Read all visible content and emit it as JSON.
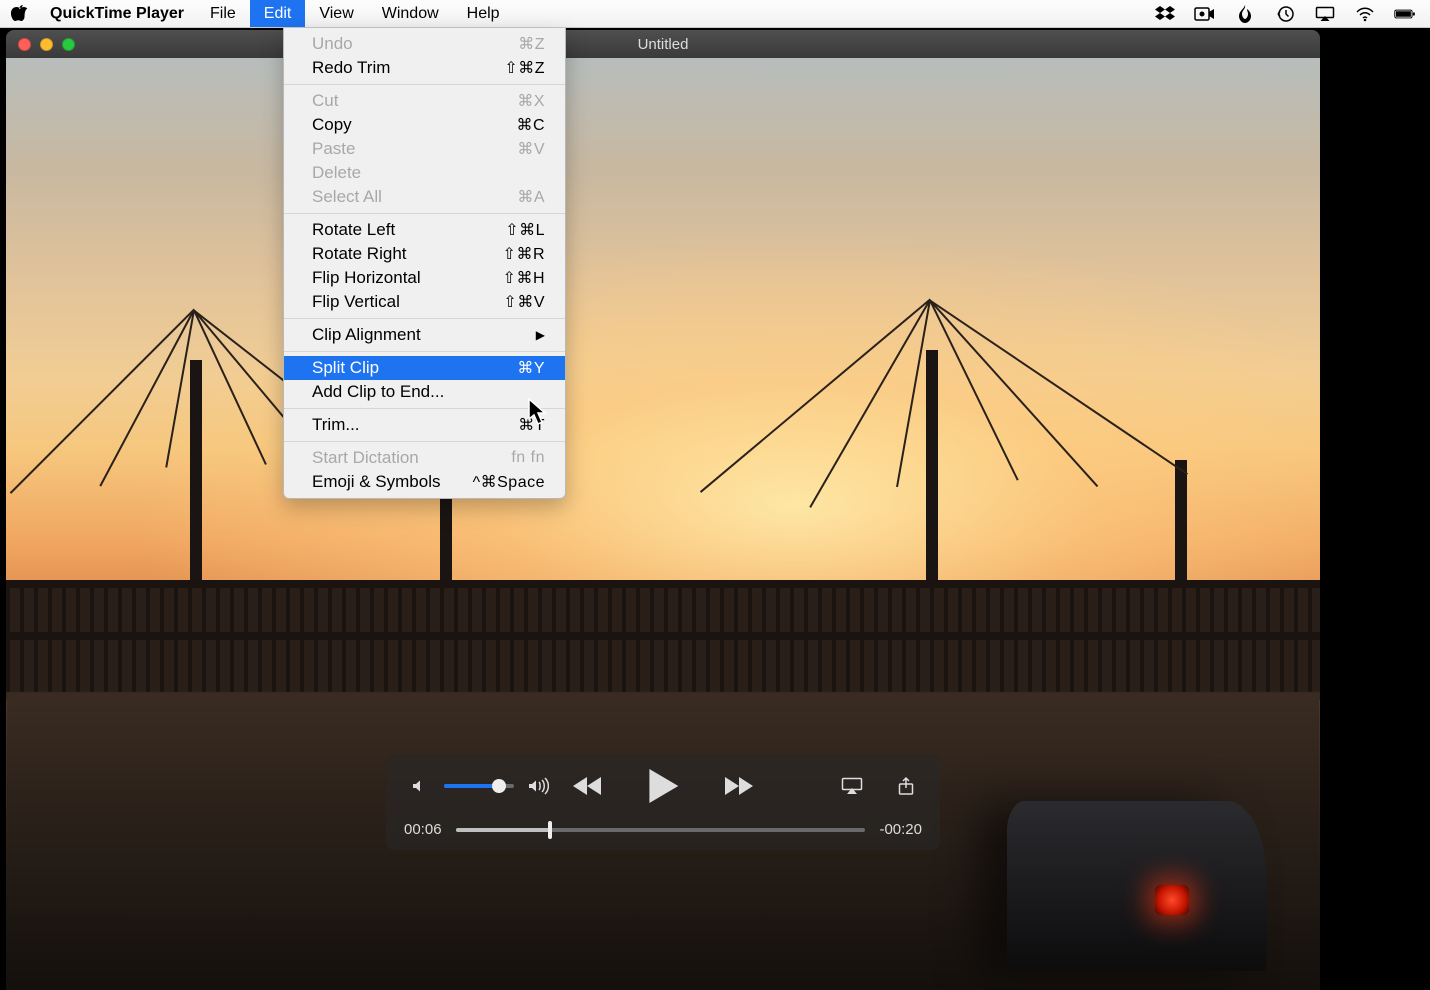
{
  "menubar": {
    "app_name": "QuickTime Player",
    "items": [
      {
        "label": "File"
      },
      {
        "label": "Edit"
      },
      {
        "label": "View"
      },
      {
        "label": "Window"
      },
      {
        "label": "Help"
      }
    ],
    "open_index": 1
  },
  "status_icons": [
    "dropbox-icon",
    "record-icon",
    "flame-icon",
    "history-icon",
    "airplay-icon",
    "wifi-icon",
    "battery-icon"
  ],
  "dropdown": {
    "groups": [
      [
        {
          "label": "Undo",
          "shortcut": "⌘Z",
          "disabled": true
        },
        {
          "label": "Redo Trim",
          "shortcut": "⇧⌘Z"
        }
      ],
      [
        {
          "label": "Cut",
          "shortcut": "⌘X",
          "disabled": true
        },
        {
          "label": "Copy",
          "shortcut": "⌘C"
        },
        {
          "label": "Paste",
          "shortcut": "⌘V",
          "disabled": true
        },
        {
          "label": "Delete",
          "shortcut": "",
          "disabled": true
        },
        {
          "label": "Select All",
          "shortcut": "⌘A",
          "disabled": true
        }
      ],
      [
        {
          "label": "Rotate Left",
          "shortcut": "⇧⌘L"
        },
        {
          "label": "Rotate Right",
          "shortcut": "⇧⌘R"
        },
        {
          "label": "Flip Horizontal",
          "shortcut": "⇧⌘H"
        },
        {
          "label": "Flip Vertical",
          "shortcut": "⇧⌘V"
        }
      ],
      [
        {
          "label": "Clip Alignment",
          "shortcut": "",
          "submenu": true
        }
      ],
      [
        {
          "label": "Split Clip",
          "shortcut": "⌘Y",
          "highlight": true
        },
        {
          "label": "Add Clip to End...",
          "shortcut": ""
        }
      ],
      [
        {
          "label": "Trim...",
          "shortcut": "⌘T"
        }
      ],
      [
        {
          "label": "Start Dictation",
          "shortcut": "fn fn",
          "disabled": true
        },
        {
          "label": "Emoji & Symbols",
          "shortcut": "^⌘Space"
        }
      ]
    ]
  },
  "window": {
    "title": "Untitled"
  },
  "player": {
    "elapsed": "00:06",
    "remaining": "-00:20",
    "scrub_percent": 23,
    "volume_percent": 78
  }
}
